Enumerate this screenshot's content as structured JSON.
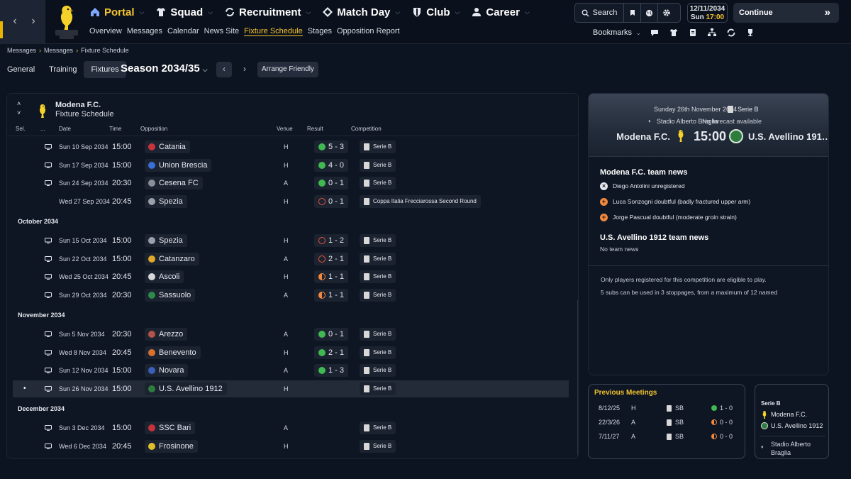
{
  "nav": {
    "main": [
      {
        "label": "Portal",
        "icon": "home-icon"
      },
      {
        "label": "Squad",
        "icon": "shirt-icon"
      },
      {
        "label": "Recruitment",
        "icon": "refresh-icon"
      },
      {
        "label": "Match Day",
        "icon": "pitch-icon"
      },
      {
        "label": "Club",
        "icon": "shield-icon"
      },
      {
        "label": "Career",
        "icon": "person-icon"
      }
    ],
    "sub": [
      "Overview",
      "Messages",
      "Calendar",
      "News Site",
      "Fixture Schedule",
      "Stages",
      "Opposition Report"
    ],
    "active_sub": "Fixture Schedule",
    "search_label": "Search",
    "date": "12/11/2034",
    "day": "Sun",
    "time": "17:00",
    "continue_label": "Continue",
    "bookmarks_label": "Bookmarks"
  },
  "breadcrumb": [
    "Messages",
    "Messages",
    "Fixture Schedule"
  ],
  "page_tabs": [
    "General",
    "Training",
    "Fixtures"
  ],
  "season": "Season 2034/35",
  "arrange_label": "Arrange Friendly",
  "club": {
    "name": "Modena F.C.",
    "subtitle": "Fixture Schedule"
  },
  "columns": {
    "sel": "Sel.",
    "dots": "...",
    "date": "Date",
    "time": "Time",
    "opposition": "Opposition",
    "venue": "Venue",
    "result": "Result",
    "competition": "Competition"
  },
  "fixtures": [
    {
      "date": "Sun 10 Sep 2034",
      "time": "15:00",
      "opp": "Catania",
      "oppColor": "#c8323c",
      "venue": "H",
      "result": "5 - 3",
      "outcome": "win",
      "comp": "Serie B"
    },
    {
      "date": "Sun 17 Sep 2034",
      "time": "15:00",
      "opp": "Union Brescia",
      "oppColor": "#3a6fd8",
      "venue": "H",
      "result": "4 - 0",
      "outcome": "win",
      "comp": "Serie B"
    },
    {
      "date": "Sun 24 Sep 2034",
      "time": "20:30",
      "opp": "Cesena FC",
      "oppColor": "#8a8f99",
      "venue": "A",
      "result": "0 - 1",
      "outcome": "win",
      "comp": "Serie B"
    },
    {
      "date": "Wed 27 Sep 2034",
      "time": "20:45",
      "opp": "Spezia",
      "oppColor": "#9aa1ab",
      "venue": "H",
      "result": "0 - 1",
      "outcome": "loss",
      "comp": "Coppa Italia Frecciarossa Second Round",
      "notv": true
    },
    {
      "month": "October 2034"
    },
    {
      "date": "Sun 15 Oct 2034",
      "time": "15:00",
      "opp": "Spezia",
      "oppColor": "#9aa1ab",
      "venue": "H",
      "result": "1 - 2",
      "outcome": "loss",
      "comp": "Serie B"
    },
    {
      "date": "Sun 22 Oct 2034",
      "time": "15:00",
      "opp": "Catanzaro",
      "oppColor": "#e0a82a",
      "venue": "A",
      "result": "2 - 1",
      "outcome": "loss",
      "comp": "Serie B"
    },
    {
      "date": "Wed 25 Oct 2034",
      "time": "20:45",
      "opp": "Ascoli",
      "oppColor": "#d8d8d8",
      "venue": "H",
      "result": "1 - 1",
      "outcome": "draw",
      "comp": "Serie B"
    },
    {
      "date": "Sun 29 Oct 2034",
      "time": "20:30",
      "opp": "Sassuolo",
      "oppColor": "#2e8a4a",
      "venue": "A",
      "result": "1 - 1",
      "outcome": "draw",
      "comp": "Serie B"
    },
    {
      "month": "November 2034"
    },
    {
      "date": "Sun 5 Nov 2034",
      "time": "20:30",
      "opp": "Arezzo",
      "oppColor": "#b5524a",
      "venue": "A",
      "result": "0 - 1",
      "outcome": "win",
      "comp": "Serie B"
    },
    {
      "date": "Wed 8 Nov 2034",
      "time": "20:45",
      "opp": "Benevento",
      "oppColor": "#d8702e",
      "venue": "H",
      "result": "2 - 1",
      "outcome": "win",
      "comp": "Serie B"
    },
    {
      "date": "Sun 12 Nov 2034",
      "time": "15:00",
      "opp": "Novara",
      "oppColor": "#3b5fb8",
      "venue": "A",
      "result": "1 - 3",
      "outcome": "win",
      "comp": "Serie B"
    },
    {
      "date": "Sun 26 Nov 2034",
      "time": "15:00",
      "opp": "U.S. Avellino 1912",
      "oppColor": "#2e7d3e",
      "venue": "H",
      "result": "",
      "outcome": "",
      "comp": "Serie B",
      "selected": true,
      "marker": "•"
    },
    {
      "month": "December 2034"
    },
    {
      "date": "Sun 3 Dec 2034",
      "time": "15:00",
      "opp": "SSC Bari",
      "oppColor": "#c8323c",
      "venue": "A",
      "result": "",
      "outcome": "",
      "comp": "Serie B"
    },
    {
      "date": "Wed 6 Dec 2034",
      "time": "20:45",
      "opp": "Frosinone",
      "oppColor": "#e0c02a",
      "venue": "H",
      "result": "",
      "outcome": "",
      "comp": "Serie B"
    }
  ],
  "outcome_colors": {
    "win": "#3fb950",
    "loss": "#e5533d",
    "draw": "#f0883e"
  },
  "match": {
    "date": "Sunday 26th November 2034",
    "competition": "Serie B",
    "stadium": "Stadio Alberto Braglia",
    "forecast": "No forecast available",
    "home": "Modena F.C.",
    "kickoff": "15:00",
    "away": "U.S. Avellino 191…"
  },
  "team_news": {
    "home_title": "Modena F.C. team news",
    "home_items": [
      {
        "text": "Diego Antolini unregistered",
        "icon": "x-icon",
        "color": "#e6e9ef"
      },
      {
        "text": "Luca Sonzogni doubtful (badly fractured upper arm)",
        "icon": "plus-icon",
        "color": "#f0883e"
      },
      {
        "text": "Jorge Pascual doubtful (moderate groin strain)",
        "icon": "plus-icon",
        "color": "#f0883e"
      }
    ],
    "away_title": "U.S. Avellino 1912 team news",
    "away_none": "No team news"
  },
  "rules": [
    "Only players registered for this competition are eligible to play.",
    "5 subs can be used in 3 stoppages, from a maximum of 12 named"
  ],
  "previous_meetings": {
    "title": "Previous Meetings",
    "rows": [
      {
        "date": "8/12/25",
        "venue": "H",
        "comp": "SB",
        "score": "1 - 0",
        "outcome": "win"
      },
      {
        "date": "22/3/26",
        "venue": "A",
        "comp": "SB",
        "score": "0 - 0",
        "outcome": "draw"
      },
      {
        "date": "7/11/27",
        "venue": "A",
        "comp": "SB",
        "score": "0 - 0",
        "outcome": "draw"
      }
    ]
  },
  "venue_card": {
    "competition": "Serie B",
    "home": "Modena F.C.",
    "away": "U.S. Avellino 1912",
    "stadium": "Stadio Alberto Braglia"
  }
}
